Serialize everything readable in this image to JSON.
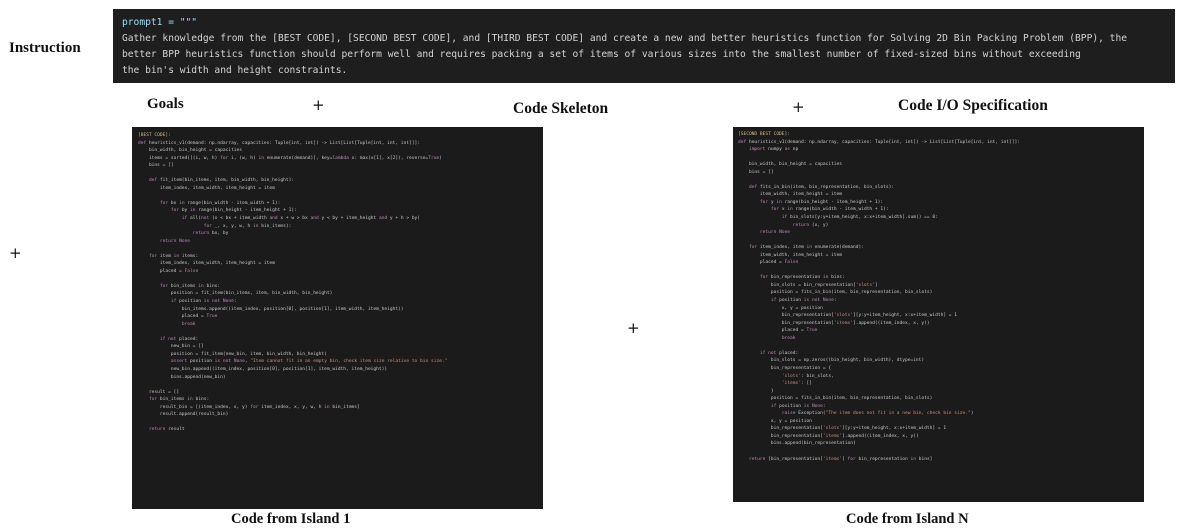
{
  "labels": {
    "instruction": "Instruction",
    "goals": "Goals",
    "code_skeleton": "Code Skeleton",
    "code_io_spec": "Code I/O Specification",
    "island1": "Code from Island 1",
    "islandN": "Code from Island N",
    "plus": "+"
  },
  "prompt": {
    "header": "prompt1 = \"\"\"",
    "line1": "Gather knowledge from the [BEST CODE], [SECOND BEST CODE], and [THIRD BEST CODE] and create a new and better heuristics function for Solving 2D Bin Packing Problem (BPP), the",
    "line2": "better BPP heuristics function should perform well and requires packing a set of items of various sizes into the smallest number of fixed-sized bins without exceeding",
    "line3": "the bin's width and height constraints."
  },
  "code_island1": [
    "[BEST CODE]:",
    "def heuristics_v1(demand: np.ndarray, capacities: Tuple[int, int]) -> List[List[Tuple[int, int, int]]]:",
    "    bin_width, bin_height = capacities",
    "    items = sorted([(i, w, h) for i, (w, h) in enumerate(demand)], key=lambda x: max(x[1], x[2]), reverse=True)",
    "    bins = []",
    "",
    "    def fit_item(bin_items, item, bin_width, bin_height):",
    "        item_index, item_width, item_height = item",
    "",
    "        for bx in range(bin_width - item_width + 1):",
    "            for by in range(bin_height - item_height + 1):",
    "                if all(not (x < bx + item_width and x + w > bx and y < by + item_height and y + h > by)",
    "                        for _, x, y, w, h in bin_items):",
    "                    return bx, by",
    "        return None",
    "",
    "    for item in items:",
    "        item_index, item_width, item_height = item",
    "        placed = False",
    "",
    "        for bin_items in bins:",
    "            position = fit_item(bin_items, item, bin_width, bin_height)",
    "            if position is not None:",
    "                bin_items.append((item_index, position[0], position[1], item_width, item_height))",
    "                placed = True",
    "                break",
    "",
    "        if not placed:",
    "            new_bin = []",
    "            position = fit_item(new_bin, item, bin_width, bin_height)",
    "            assert position is not None, \"Item cannot fit in an empty bin, check item size relative to bin size.\"",
    "            new_bin.append((item_index, position[0], position[1], item_width, item_height))",
    "            bins.append(new_bin)",
    "",
    "    result = []",
    "    for bin_items in bins:",
    "        result_bin = [(item_index, x, y) for item_index, x, y, w, h in bin_items]",
    "        result.append(result_bin)",
    "",
    "    return result"
  ],
  "code_islandN": [
    "[SECOND BEST CODE]:",
    "def heuristics_v1(demand: np.ndarray, capacities: Tuple[int, int]) -> List[List[Tuple[int, int, int]]]:",
    "    import numpy as np",
    "",
    "    bin_width, bin_height = capacities",
    "    bins = []",
    "",
    "    def fits_in_bin(item, bin_representation, bin_slots):",
    "        item_width, item_height = item",
    "        for y in range(bin_height - item_height + 1):",
    "            for x in range(bin_width - item_width + 1):",
    "                if bin_slots[y:y+item_height, x:x+item_width].sum() == 0:",
    "                    return (x, y)",
    "        return None",
    "",
    "    for item_index, item in enumerate(demand):",
    "        item_width, item_height = item",
    "        placed = False",
    "",
    "        for bin_representation in bins:",
    "            bin_slots = bin_representation['slots']",
    "            position = fits_in_bin(item, bin_representation, bin_slots)",
    "            if position is not None:",
    "                x, y = position",
    "                bin_representation['slots'][y:y+item_height, x:x+item_width] = 1",
    "                bin_representation['items'].append((item_index, x, y))",
    "                placed = True",
    "                break",
    "",
    "        if not placed:",
    "            bin_slots = np.zeros((bin_height, bin_width), dtype=int)",
    "            bin_representation = {",
    "                'slots': bin_slots,",
    "                'items': []",
    "            }",
    "            position = fits_in_bin(item, bin_representation, bin_slots)",
    "            if position is None:",
    "                raise Exception(\"The item does not fit in a new bin, check bin size.\")",
    "            x, y = position",
    "            bin_representation['slots'][y:y+item_height, x:x+item_width] = 1",
    "            bin_representation['items'].append((item_index, x, y))",
    "            bins.append(bin_representation)",
    "",
    "    return [bin_representation['items'] for bin_representation in bins]"
  ]
}
